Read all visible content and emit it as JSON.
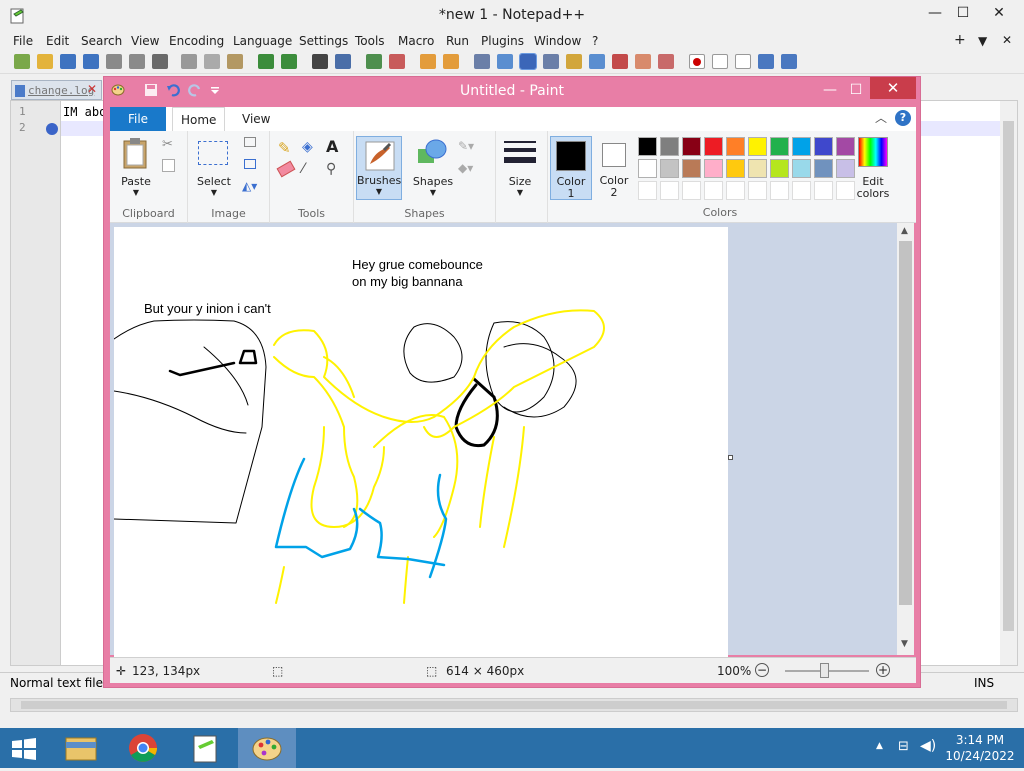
{
  "npp": {
    "title": "*new 1 - Notepad++",
    "window_controls": {
      "minimize": "—",
      "maximize": "☐",
      "close": "✕"
    },
    "menu": [
      "File",
      "Edit",
      "Search",
      "View",
      "Encoding",
      "Language",
      "Settings",
      "Tools",
      "Macro",
      "Run",
      "Plugins",
      "Window",
      "?"
    ],
    "menu_right": {
      "plus": "+",
      "down": "▼",
      "close": "✕"
    },
    "tab": {
      "label": "change.log",
      "close": "✕"
    },
    "line_numbers": [
      "1",
      "2"
    ],
    "code_line1": "IM abo",
    "status": {
      "file_type": "Normal text file",
      "mode": "INS"
    }
  },
  "paint": {
    "title": "Untitled - Paint",
    "window_controls": {
      "minimize": "—",
      "maximize": "☐",
      "close": "✕"
    },
    "tabs": {
      "file": "File",
      "home": "Home",
      "view": "View"
    },
    "help": "?",
    "ribbon": {
      "clipboard": {
        "label": "Clipboard",
        "paste": "Paste"
      },
      "image": {
        "label": "Image",
        "select": "Select"
      },
      "tools": {
        "label": "Tools"
      },
      "brushes": "Brushes",
      "shapes": {
        "label": "Shapes",
        "button": "Shapes"
      },
      "size": "Size",
      "color1": {
        "line1": "Color",
        "line2": "1",
        "value": "#000000"
      },
      "color2": {
        "line1": "Color",
        "line2": "2",
        "value": "#ffffff"
      },
      "colors_label": "Colors",
      "edit_colors": {
        "line1": "Edit",
        "line2": "colors"
      },
      "palette_row1": [
        "#000000",
        "#7f7f7f",
        "#880015",
        "#ed1c24",
        "#ff7f27",
        "#fff200",
        "#22b14c",
        "#00a2e8",
        "#3f48cc",
        "#a349a4"
      ],
      "palette_row2": [
        "#ffffff",
        "#c3c3c3",
        "#b97a57",
        "#ffaec9",
        "#ffc90e",
        "#efe4b0",
        "#b5e61d",
        "#99d9ea",
        "#7092be",
        "#c8bfe7"
      ]
    },
    "canvas_text": {
      "line1": "Hey grue comebounce",
      "line2": "on my big bannana",
      "line3": "But your y inion i can't"
    },
    "status": {
      "cursor": "123, 134px",
      "size": "614 × 460px",
      "zoom": "100%",
      "zoom_out": "−",
      "zoom_in": "+"
    }
  },
  "taskbar": {
    "time": "3:14 PM",
    "date": "10/24/2022"
  }
}
